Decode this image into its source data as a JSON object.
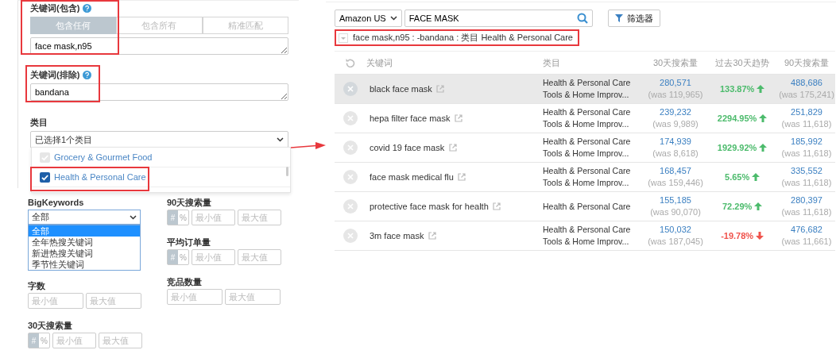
{
  "keyword_include": {
    "label": "关键词(包含)",
    "modes": [
      {
        "label": "包含任何",
        "selected": true
      },
      {
        "label": "包含所有",
        "selected": false
      },
      {
        "label": "精准匹配",
        "selected": false
      }
    ],
    "value": "face mask,n95"
  },
  "keyword_exclude": {
    "label": "关键词(排除)",
    "value": "bandana"
  },
  "category": {
    "label": "类目",
    "value": "已选择1个类目",
    "options": [
      {
        "label": "Grocery & Gourmet Food",
        "checked": false
      },
      {
        "label": "Health & Personal Care",
        "checked": true
      }
    ]
  },
  "filters_left": [
    {
      "kind": "select",
      "label": "BigKeywords",
      "value": "全部",
      "options": [
        {
          "label": "全部",
          "selected": true
        },
        {
          "label": "全年热搜关键词",
          "selected": false
        },
        {
          "label": "新进热搜关键词",
          "selected": false
        },
        {
          "label": "季节性关键词",
          "selected": false
        }
      ]
    },
    {
      "kind": "range",
      "label": "字数",
      "min_placeholder": "最小值",
      "max_placeholder": "最大值"
    },
    {
      "kind": "range",
      "label": "30天搜索量",
      "units": [
        {
          "label": "#",
          "selected": true
        },
        {
          "label": "%",
          "selected": false
        }
      ],
      "min_placeholder": "最小值",
      "max_placeholder": "最大值"
    }
  ],
  "filters_right": [
    {
      "kind": "range",
      "label": "90天搜索量",
      "units": [
        {
          "label": "#",
          "selected": true
        },
        {
          "label": "%",
          "selected": false
        }
      ],
      "min_placeholder": "最小值",
      "max_placeholder": "最大值"
    },
    {
      "kind": "range",
      "label": "平均订单量",
      "units": [
        {
          "label": "#",
          "selected": true
        },
        {
          "label": "%",
          "selected": false
        }
      ],
      "min_placeholder": "最小值",
      "max_placeholder": "最大值"
    },
    {
      "kind": "range",
      "label": "竞品数量",
      "min_placeholder": "最小值",
      "max_placeholder": "最大值"
    }
  ],
  "marketplace": "Amazon US",
  "search": "FACE MASK",
  "filter_button": "筛选器",
  "summary": "face mask,n95 : -bandana : 类目 Health & Personal Care",
  "table": {
    "columns": [
      "关键词",
      "类目",
      "30天搜索量",
      "过去30天趋势",
      "90天搜索量"
    ],
    "rows": [
      {
        "selected": true,
        "keyword": "black face mask",
        "categories": [
          "Health & Personal Care",
          "Tools & Home Improv..."
        ],
        "search_30": "280,571",
        "was_30": "(was 119,965)",
        "trend": "133.87%",
        "rising": true,
        "search_90": "488,686",
        "was_90": "(was 175,241)"
      },
      {
        "selected": false,
        "keyword": "hepa filter face mask",
        "categories": [
          "Health & Personal Care",
          "Tools & Home Improv..."
        ],
        "search_30": "239,232",
        "was_30": "(was 9,989)",
        "trend": "2294.95%",
        "rising": true,
        "search_90": "251,829",
        "was_90": "(was 11,618)"
      },
      {
        "selected": false,
        "keyword": "covid 19 face mask",
        "categories": [
          "Health & Personal Care",
          "Tools & Home Improv..."
        ],
        "search_30": "174,939",
        "was_30": "(was 8,618)",
        "trend": "1929.92%",
        "rising": true,
        "search_90": "185,992",
        "was_90": "(was 11,618)"
      },
      {
        "selected": false,
        "keyword": "face mask medical flu",
        "categories": [
          "Health & Personal Care",
          "Tools & Home Improv..."
        ],
        "search_30": "168,457",
        "was_30": "(was 159,446)",
        "trend": "5.65%",
        "rising": true,
        "search_90": "335,552",
        "was_90": "(was 11,618)"
      },
      {
        "selected": false,
        "keyword": "protective face mask for health",
        "categories": [
          "Health & Personal Care"
        ],
        "search_30": "155,185",
        "was_30": "(was 90,070)",
        "trend": "72.29%",
        "rising": true,
        "search_90": "280,397",
        "was_90": "(was 11,618)"
      },
      {
        "selected": false,
        "keyword": "3m face mask",
        "categories": [
          "Health & Personal Care",
          "Tools & Home Improv..."
        ],
        "search_30": "150,032",
        "was_30": "(was 187,045)",
        "trend": "-19.78%",
        "rising": false,
        "search_90": "476,682",
        "was_90": "(was 11,661)"
      }
    ]
  }
}
